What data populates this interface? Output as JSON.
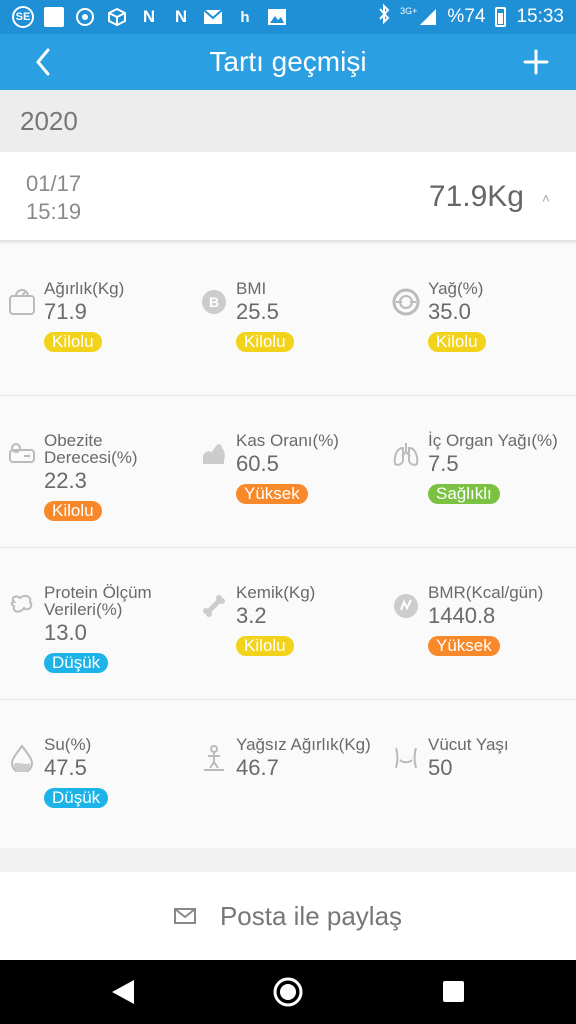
{
  "status_bar": {
    "left_icons": [
      "SE",
      "",
      "",
      "",
      "N",
      "N",
      "",
      "h",
      ""
    ],
    "network": "3G+",
    "battery": "%74",
    "time": "15:33"
  },
  "app_bar": {
    "title": "Tartı geçmişi"
  },
  "year": "2020",
  "record": {
    "date": "01/17",
    "time": "15:19",
    "weight": "71.9Kg",
    "caret": "˄"
  },
  "metrics": [
    {
      "label": "Ağırlık(Kg)",
      "value": "71.9",
      "status": "Kilolu",
      "status_color": "#f2d21b",
      "icon": "scale-icon"
    },
    {
      "label": "BMI",
      "value": "25.5",
      "status": "Kilolu",
      "status_color": "#f2d21b",
      "icon": "bmi-icon"
    },
    {
      "label": "Yağ(%)",
      "value": "35.0",
      "status": "Kilolu",
      "status_color": "#f2d21b",
      "icon": "fat-icon"
    },
    {
      "label": "Obezite Derecesi(%)",
      "value": "22.3",
      "status": "Kilolu",
      "status_color": "#f7892b",
      "icon": "obesity-icon"
    },
    {
      "label": "Kas Oranı(%)",
      "value": "60.5",
      "status": "Yüksek",
      "status_color": "#f7892b",
      "icon": "muscle-icon"
    },
    {
      "label": "İç Organ Yağı(%)",
      "value": "7.5",
      "status": "Sağlıklı",
      "status_color": "#7cc242",
      "icon": "lungs-icon"
    },
    {
      "label": "Protein Ölçüm Verileri(%)",
      "value": "13.0",
      "status": "Düşük",
      "status_color": "#1bb3e8",
      "icon": "protein-icon"
    },
    {
      "label": "Kemik(Kg)",
      "value": "3.2",
      "status": "Kilolu",
      "status_color": "#f2d21b",
      "icon": "bone-icon"
    },
    {
      "label": "BMR(Kcal/gün)",
      "value": "1440.8",
      "status": "Yüksek",
      "status_color": "#f7892b",
      "icon": "bmr-icon"
    },
    {
      "label": "Su(%)",
      "value": "47.5",
      "status": "Düşük",
      "status_color": "#1bb3e8",
      "icon": "water-drop-icon"
    },
    {
      "label": "Yağsız Ağırlık(Kg)",
      "value": "46.7",
      "status": "",
      "status_color": "",
      "icon": "lean-body-icon"
    },
    {
      "label": "Vücut Yaşı",
      "value": "50",
      "status": "",
      "status_color": "",
      "icon": "body-age-icon"
    }
  ],
  "share": {
    "label": "Posta ile paylaş"
  }
}
